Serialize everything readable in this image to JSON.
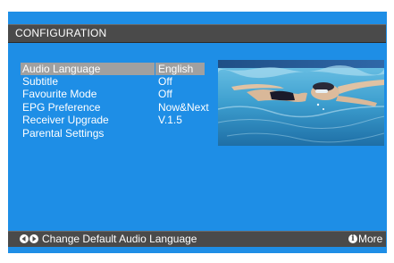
{
  "header": {
    "title": "CONFIGURATION"
  },
  "menu": {
    "items": [
      {
        "label": "Audio Language",
        "value": "English",
        "selected": true
      },
      {
        "label": "Subtitle",
        "value": "Off"
      },
      {
        "label": "Favourite Mode",
        "value": "Off"
      },
      {
        "label": "EPG Preference",
        "value": "Now&Next"
      },
      {
        "label": "Receiver Upgrade",
        "value": "V.1.5"
      },
      {
        "label": "Parental Settings",
        "value": ""
      }
    ]
  },
  "footer": {
    "hint": "Change Default Audio Language",
    "more_icon_glyph": "i",
    "more_label": "More"
  },
  "icons": {
    "left": "arrow-left-icon",
    "right": "arrow-right-icon",
    "info": "info-icon"
  },
  "colors": {
    "screen_background": "#1e8ee6",
    "bar_background": "#4a4a4a",
    "selection": "#a0a0a0",
    "text": "#ffffff"
  }
}
